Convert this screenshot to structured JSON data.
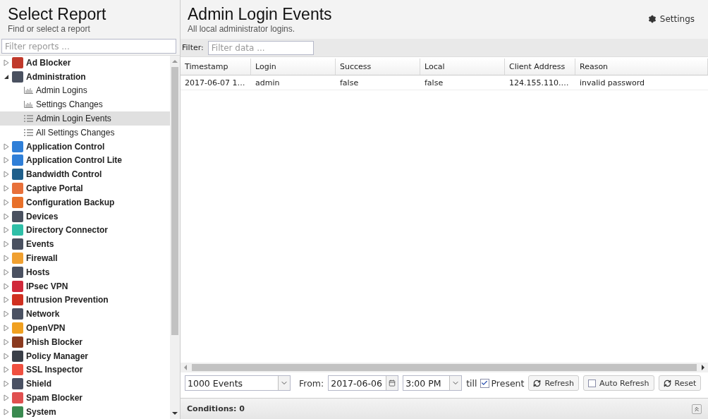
{
  "sidebar": {
    "title": "Select Report",
    "subtitle": "Find or select a report",
    "filter": {
      "placeholder": "Filter reports ..."
    },
    "items": [
      {
        "label": "Ad Blocker",
        "color": "#c0392b",
        "expanded": false
      },
      {
        "label": "Administration",
        "color": "#4a5160",
        "expanded": true,
        "children": [
          {
            "label": "Admin Logins",
            "kind": "chart",
            "selected": false
          },
          {
            "label": "Settings Changes",
            "kind": "chart",
            "selected": false
          },
          {
            "label": "Admin Login Events",
            "kind": "list",
            "selected": true
          },
          {
            "label": "All Settings Changes",
            "kind": "list",
            "selected": false
          }
        ]
      },
      {
        "label": "Application Control",
        "color": "#2f7fd8",
        "expanded": false
      },
      {
        "label": "Application Control Lite",
        "color": "#2f7fd8",
        "expanded": false
      },
      {
        "label": "Bandwidth Control",
        "color": "#1f5f8b",
        "expanded": false
      },
      {
        "label": "Captive Portal",
        "color": "#e8703a",
        "expanded": false
      },
      {
        "label": "Configuration Backup",
        "color": "#e8702a",
        "expanded": false
      },
      {
        "label": "Devices",
        "color": "#4a5160",
        "expanded": false
      },
      {
        "label": "Directory Connector",
        "color": "#2fbfa8",
        "expanded": false
      },
      {
        "label": "Events",
        "color": "#4a5160",
        "expanded": false
      },
      {
        "label": "Firewall",
        "color": "#f0a030",
        "expanded": false
      },
      {
        "label": "Hosts",
        "color": "#4a5161",
        "expanded": false
      },
      {
        "label": "IPsec VPN",
        "color": "#d0283a",
        "expanded": false
      },
      {
        "label": "Intrusion Prevention",
        "color": "#d03020",
        "expanded": false
      },
      {
        "label": "Network",
        "color": "#4a5162",
        "expanded": false
      },
      {
        "label": "OpenVPN",
        "color": "#f0a020",
        "expanded": false
      },
      {
        "label": "Phish Blocker",
        "color": "#8b3a1f",
        "expanded": false
      },
      {
        "label": "Policy Manager",
        "color": "#3a3f48",
        "expanded": false
      },
      {
        "label": "SSL Inspector",
        "color": "#f05040",
        "expanded": false
      },
      {
        "label": "Shield",
        "color": "#4a5163",
        "expanded": false
      },
      {
        "label": "Spam Blocker",
        "color": "#e05050",
        "expanded": false
      },
      {
        "label": "System",
        "color": "#3a8a50",
        "expanded": false
      }
    ]
  },
  "report": {
    "title": "Admin Login Events",
    "subtitle": "All local administrator logins.",
    "settings_button": "Settings",
    "filter": {
      "label": "Filter:",
      "placeholder": "Filter data ..."
    },
    "table": {
      "columns": [
        "Timestamp",
        "Login",
        "Success",
        "Local",
        "Client Address",
        "Reason"
      ],
      "rows": [
        [
          "2017-06-07 1…",
          "admin",
          "false",
          "false",
          "124.155.110.…",
          "invalid password"
        ]
      ]
    },
    "toolbar": {
      "limit": "1000 Events",
      "from_label": "From:",
      "date": "2017-06-06",
      "time": "3:00 PM",
      "till_label": "till",
      "present": {
        "label": "Present",
        "checked": true
      },
      "refresh": "Refresh",
      "auto_refresh": {
        "label": "Auto Refresh",
        "checked": false
      },
      "reset": "Reset"
    },
    "conditions": "Conditions: 0"
  }
}
